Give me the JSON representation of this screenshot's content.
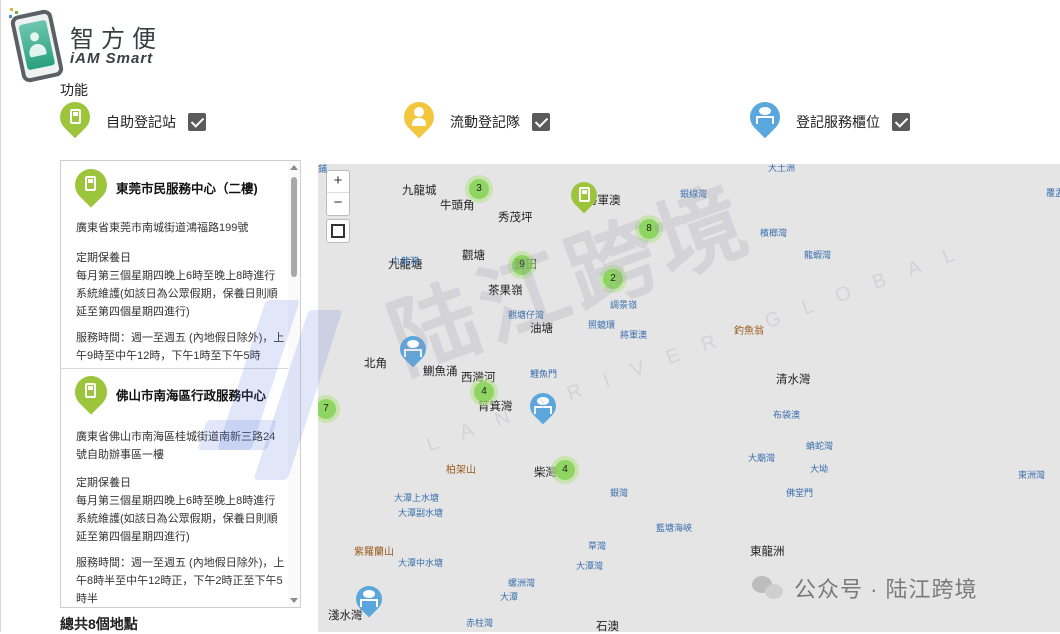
{
  "logo": {
    "title": "智方便",
    "subtitle": "iAM Smart"
  },
  "colors": {
    "kiosk_green": "#9cc53c",
    "mobile_yellow": "#f2c63d",
    "counter_blue": "#5aa7dd",
    "map_background": "#e5e5e5",
    "cluster_green": "#8fd05a"
  },
  "functions": {
    "label": "功能",
    "filters": [
      {
        "label": "自助登記站",
        "icon": "kiosk-icon",
        "checked": true
      },
      {
        "label": "流動登記隊",
        "icon": "mobile-team-icon",
        "checked": true
      },
      {
        "label": "登記服務櫃位",
        "icon": "service-counter-icon",
        "checked": true
      }
    ]
  },
  "locations": [
    {
      "name": "東莞市民服務中心（二樓)",
      "address": "廣東省東莞市南城街道鴻福路199號",
      "maintenance": "定期保養日\n每月第三個星期四晚上6時至晚上8時進行系統維護(如該日為公眾假期，保養日則順延至第四個星期四進行)",
      "hours": "服務時間：週一至週五 (內地假日除外)，上午9時至中午12時，下午1時至下午5時"
    },
    {
      "name": "佛山市南海區行政服務中心",
      "address": "廣東省佛山市南海區桂城街道南新三路24號自助辦事區一樓",
      "maintenance": "定期保養日\n每月第三個星期四晚上6時至晚上8時進行系統維護(如該日為公眾假期，保養日則順延至第四個星期四進行)",
      "hours": "服務時間：週一至週五 (內地假日除外)，上午8時半至中午12時正，下午2時正至下午5時半"
    }
  ],
  "total_label": "總共8個地點",
  "map": {
    "zoom_in": "+",
    "zoom_out": "−",
    "places": [
      {
        "name": "九龍城",
        "cls": "big"
      },
      {
        "name": "九龍塘",
        "cls": "big"
      },
      {
        "name": "牛頭角",
        "cls": "big"
      },
      {
        "name": "秀茂坪",
        "cls": "big"
      },
      {
        "name": "將軍澳",
        "cls": "big"
      },
      {
        "name": "觀塘",
        "cls": "big"
      },
      {
        "name": "藍田",
        "cls": "big"
      },
      {
        "name": "茶果嶺",
        "cls": "big"
      },
      {
        "name": "油塘",
        "cls": "big"
      },
      {
        "name": "北角",
        "cls": "big"
      },
      {
        "name": "鰂魚涌",
        "cls": "big"
      },
      {
        "name": "西灣河",
        "cls": "big"
      },
      {
        "name": "筲箕灣",
        "cls": "big"
      },
      {
        "name": "清水灣",
        "cls": "big"
      },
      {
        "name": "柴灣",
        "cls": "big"
      },
      {
        "name": "東龍洲",
        "cls": "big"
      },
      {
        "name": "淺水灣",
        "cls": "big"
      },
      {
        "name": "石澳",
        "cls": "big"
      },
      {
        "name": "大土洲",
        "cls": "water"
      },
      {
        "name": "銀線灣",
        "cls": "water"
      },
      {
        "name": "檳榔灣",
        "cls": "water"
      },
      {
        "name": "龍蝦灣",
        "cls": "water"
      },
      {
        "name": "九龍灣",
        "cls": "water"
      },
      {
        "name": "觀塘仔灣",
        "cls": "water"
      },
      {
        "name": "照鏡環",
        "cls": "water"
      },
      {
        "name": "調景嶺",
        "cls": "water"
      },
      {
        "name": "將軍澳",
        "cls": "water"
      },
      {
        "name": "鯉魚門",
        "cls": "water"
      },
      {
        "name": "布袋澳",
        "cls": "water"
      },
      {
        "name": "蚺蛇灣",
        "cls": "water"
      },
      {
        "name": "大廟灣",
        "cls": "water"
      },
      {
        "name": "大坳",
        "cls": "water"
      },
      {
        "name": "佛堂門",
        "cls": "water"
      },
      {
        "name": "大潭上水塘",
        "cls": "water"
      },
      {
        "name": "大潭副水塘",
        "cls": "water"
      },
      {
        "name": "銀灣",
        "cls": "water"
      },
      {
        "name": "藍塘海峽",
        "cls": "water"
      },
      {
        "name": "草灣",
        "cls": "water"
      },
      {
        "name": "大潭灣",
        "cls": "water"
      },
      {
        "name": "大潭中水塘",
        "cls": "water"
      },
      {
        "name": "螺洲灣",
        "cls": "water"
      },
      {
        "name": "大潭",
        "cls": "water"
      },
      {
        "name": "赤柱灣",
        "cls": "water"
      },
      {
        "name": "東洲灣",
        "cls": "water"
      },
      {
        "name": "覆盂灣",
        "cls": "water"
      },
      {
        "name": "鋪",
        "cls": "water"
      },
      {
        "name": "柏架山",
        "cls": "mount"
      },
      {
        "name": "紫羅蘭山",
        "cls": "mount"
      },
      {
        "name": "釣魚翁",
        "cls": "mount"
      }
    ],
    "clusters": [
      "3",
      "8",
      "9",
      "2",
      "4",
      "7",
      "4"
    ]
  },
  "watermark": {
    "brand": "陆江跨境",
    "tagline": "LANDRIVER GLOBAL",
    "footer": "公众号 · 陆江跨境"
  }
}
